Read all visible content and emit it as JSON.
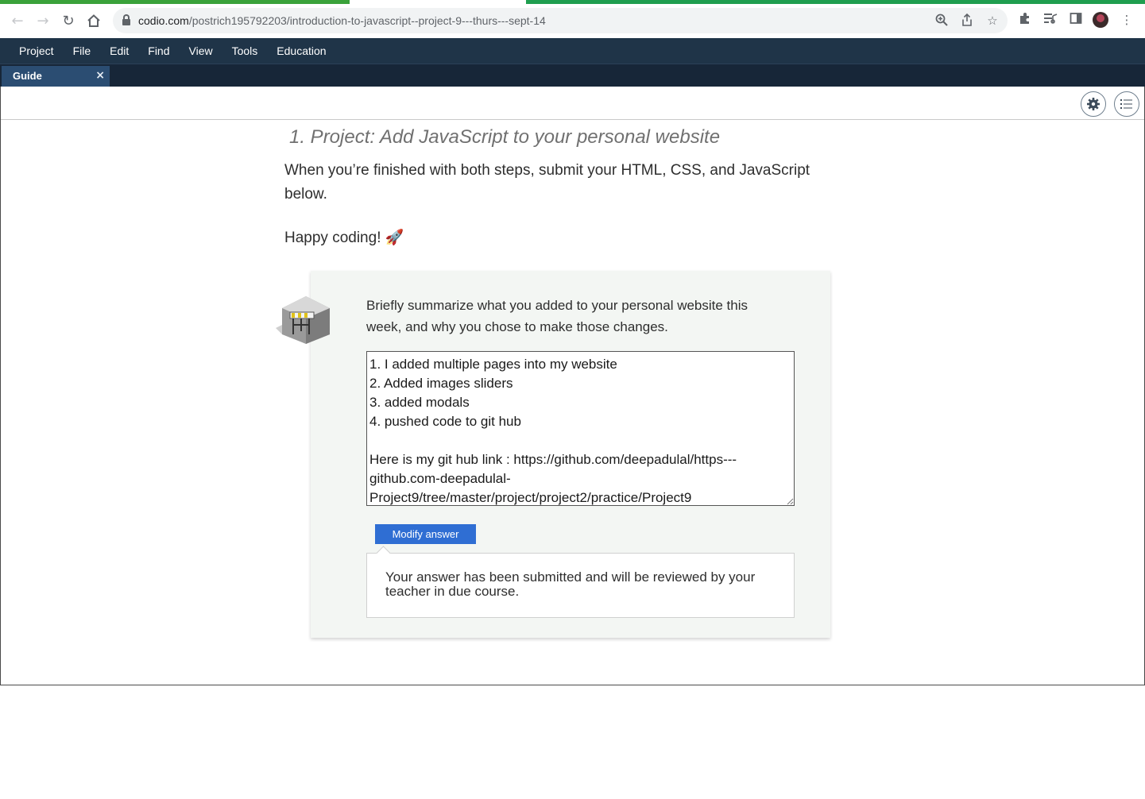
{
  "browser": {
    "url_domain": "codio.com",
    "url_path": "/postrich195792203/introduction-to-javascript--project-9---thurs---sept-14"
  },
  "menubar": {
    "items": [
      "Project",
      "File",
      "Edit",
      "Find",
      "View",
      "Tools",
      "Education"
    ]
  },
  "tabs": [
    {
      "label": "Guide",
      "close": "×"
    }
  ],
  "guide": {
    "heading": "1. Project: Add JavaScript to your personal website",
    "intro": "When you’re finished with both steps, submit your HTML, CSS, and JavaScript below.",
    "happy": "Happy coding! 🚀",
    "question": {
      "prompt": "Briefly summarize what you added to your personal website this week, and why you chose to make those changes.",
      "answer": "1. I added multiple pages into my website\n2. Added images sliders\n3. added modals\n4. pushed code to git hub\n\nHere is my git hub link : https://github.com/deepadulal/https---github.com-deepadulal-Project9/tree/master/project/project2/practice/Project9",
      "modify_button": "Modify answer",
      "feedback": "Your answer has been submitted and will be reviewed by your teacher in due course."
    }
  },
  "icons": {
    "back": "back-arrow-icon",
    "forward": "forward-arrow-icon",
    "reload": "reload-icon",
    "home": "home-icon",
    "lock": "lock-icon",
    "zoom": "zoom-icon",
    "share": "share-icon",
    "star": "star-icon",
    "extensions": "puzzle-icon",
    "reading_list": "reading-list-icon",
    "side_panel": "side-panel-icon",
    "menu": "kebab-menu-icon",
    "settings": "gear-icon",
    "toc": "list-icon"
  },
  "colors": {
    "menubar_bg": "#1f3448",
    "tab_active": "#2b4d72",
    "button_blue": "#2f6ed3",
    "card_bg": "#f3f6f3"
  }
}
